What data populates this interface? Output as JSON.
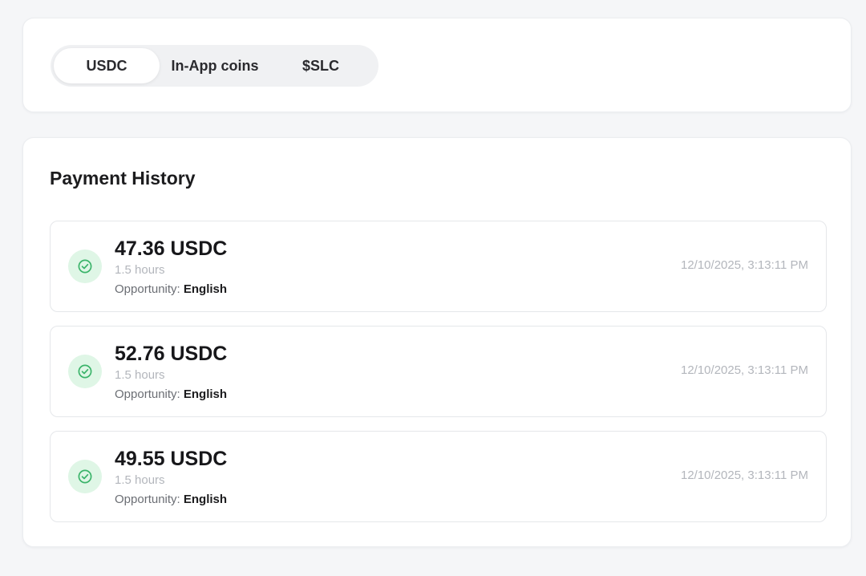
{
  "tabs": {
    "items": [
      {
        "label": "USDC",
        "active": true
      },
      {
        "label": "In-App coins",
        "active": false
      },
      {
        "label": "$SLC",
        "active": false
      }
    ]
  },
  "history": {
    "title": "Payment History",
    "opportunity_label": "Opportunity:",
    "status_icon": "check-circle-icon",
    "colors": {
      "success": "#3bb46a",
      "success_bg": "#dff6e6"
    },
    "payments": [
      {
        "amount": "47.36 USDC",
        "duration": "1.5 hours",
        "opportunity": "English",
        "timestamp": "12/10/2025, 3:13:11 PM"
      },
      {
        "amount": "52.76 USDC",
        "duration": "1.5 hours",
        "opportunity": "English",
        "timestamp": "12/10/2025, 3:13:11 PM"
      },
      {
        "amount": "49.55 USDC",
        "duration": "1.5 hours",
        "opportunity": "English",
        "timestamp": "12/10/2025, 3:13:11 PM"
      }
    ]
  }
}
